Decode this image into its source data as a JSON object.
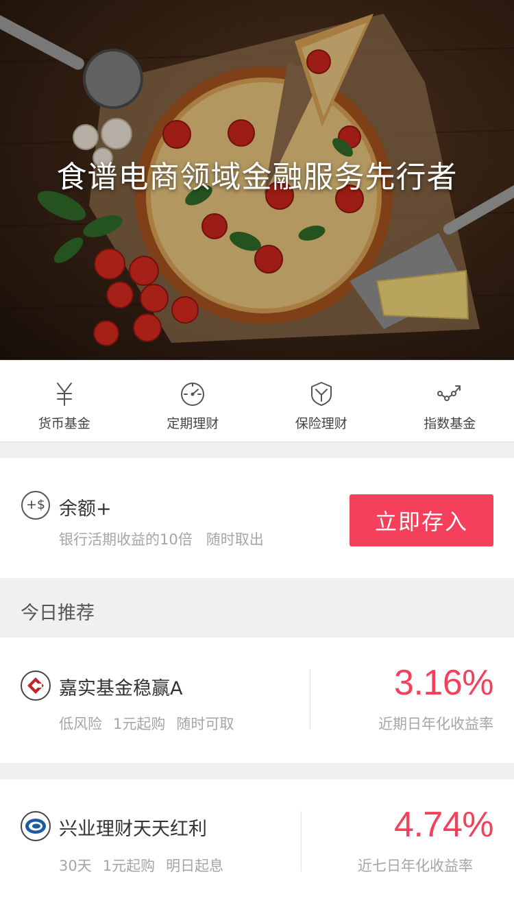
{
  "hero": {
    "title": "食谱电商领域金融服务先行者"
  },
  "nav": {
    "items": [
      {
        "icon": "yuan-icon",
        "label": "货币基金"
      },
      {
        "icon": "clock-icon",
        "label": "定期理财"
      },
      {
        "icon": "shield-icon",
        "label": "保险理财"
      },
      {
        "icon": "trend-icon",
        "label": "指数基金"
      }
    ]
  },
  "balance": {
    "icon_text": "+$",
    "name": "余额+",
    "desc": "银行活期收益的10倍   随时取出",
    "button": "立即存入"
  },
  "recommend": {
    "title": "今日推荐",
    "products": [
      {
        "name": "嘉实基金稳赢A",
        "tags": [
          "低风险",
          "1元起购",
          "随时可取"
        ],
        "rate": "3.16%",
        "rate_label": "近期日年化收益率",
        "logo": "harvest-fund-logo"
      },
      {
        "name": "兴业理财天天红利",
        "tags": [
          "30天",
          "1元起购",
          "明日起息"
        ],
        "rate": "4.74%",
        "rate_label": "近七日年化收益率",
        "logo": "cib-bank-logo"
      }
    ]
  },
  "colors": {
    "accent": "#f5405b",
    "muted_text": "#a5a5a5",
    "page_bg": "#f0f0f0"
  }
}
